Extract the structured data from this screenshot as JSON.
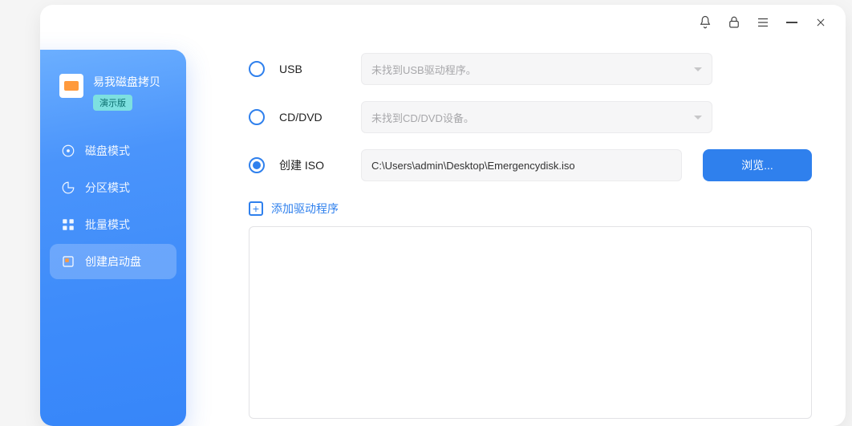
{
  "brand": {
    "title": "易我磁盘拷贝",
    "badge": "演示版"
  },
  "nav": {
    "items": [
      {
        "label": "磁盘模式"
      },
      {
        "label": "分区模式"
      },
      {
        "label": "批量模式"
      },
      {
        "label": "创建启动盘"
      }
    ],
    "active_index": 3
  },
  "options": {
    "usb": {
      "label": "USB",
      "placeholder": "未找到USB驱动程序。"
    },
    "cddvd": {
      "label": "CD/DVD",
      "placeholder": "未找到CD/DVD设备。"
    },
    "iso": {
      "label": "创建 ISO",
      "path": "C:\\Users\\admin\\Desktop\\Emergencydisk.iso"
    },
    "selected": "iso"
  },
  "buttons": {
    "browse": "浏览..."
  },
  "add_driver": {
    "label": "添加驱动程序"
  }
}
